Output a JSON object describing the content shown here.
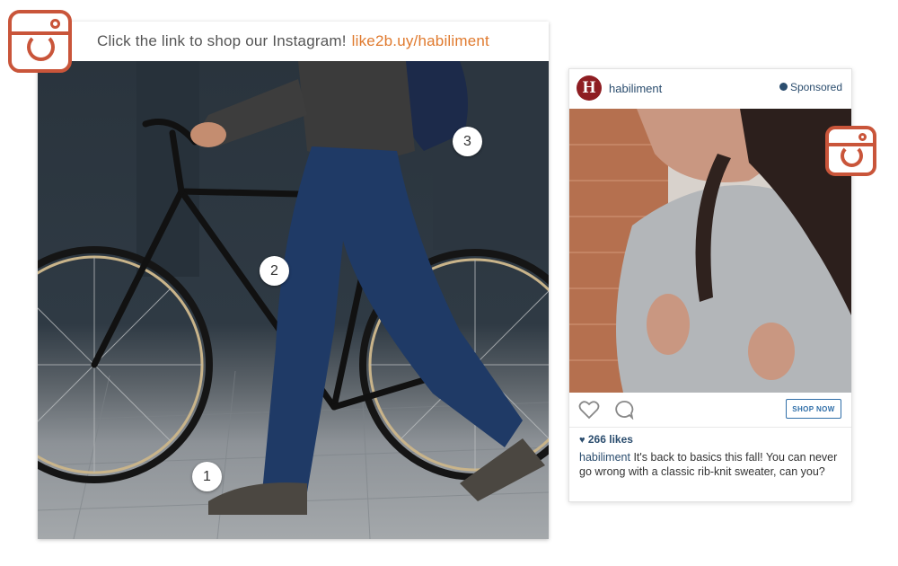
{
  "theme": {
    "accent": "#c9553a",
    "link_color": "#e07a2e",
    "brand_color": "#8e1d22",
    "instagram_blue": "#2b4d6e"
  },
  "shop_banner": {
    "text": "Click the link to shop our Instagram!",
    "link": "like2b.uy/habiliment"
  },
  "shoppable_photo": {
    "hotspots": [
      {
        "label": "1"
      },
      {
        "label": "2"
      },
      {
        "label": "3"
      }
    ]
  },
  "instagram_post": {
    "avatar_letter": "H",
    "username": "habiliment",
    "sponsored_label": "Sponsored",
    "shop_button": "SHOP NOW",
    "likes": "266 likes",
    "caption_user": "habiliment",
    "caption_text": " It's back to basics this fall! You can never go wrong with a classic rib-knit sweater, can you?"
  },
  "icons": [
    "instagram-logo-icon",
    "heart-icon",
    "comment-icon",
    "sponsored-icon"
  ]
}
